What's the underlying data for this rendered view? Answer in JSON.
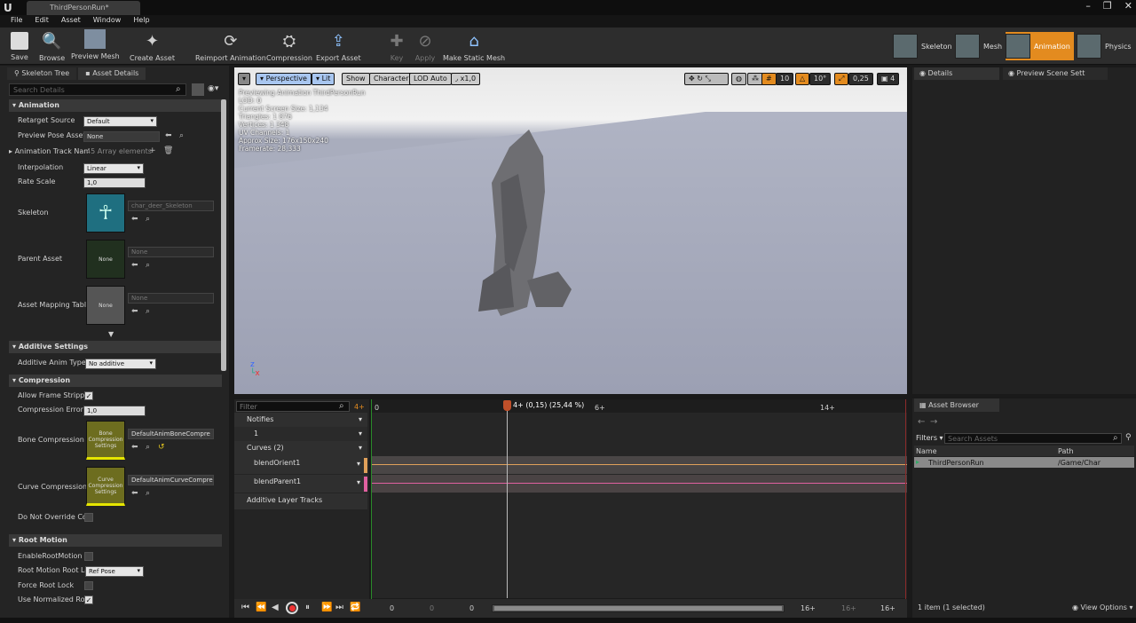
{
  "window": {
    "logo": "U",
    "tab_title": "ThirdPersonRun*"
  },
  "menu": [
    "File",
    "Edit",
    "Asset",
    "Window",
    "Help"
  ],
  "toolbar": {
    "save": "Save",
    "browse": "Browse",
    "preview_mesh": "Preview Mesh",
    "create_asset": "Create Asset",
    "reimport": "Reimport Animation",
    "compression": "Compression",
    "export_asset": "Export Asset",
    "key": "Key",
    "apply": "Apply",
    "make_static_mesh": "Make Static Mesh"
  },
  "modes": {
    "skeleton": "Skeleton",
    "mesh": "Mesh",
    "animation": "Animation",
    "physics": "Physics"
  },
  "left_tabs": {
    "skeleton_tree": "Skeleton Tree",
    "asset_details": "Asset Details"
  },
  "search": {
    "placeholder": "Search Details"
  },
  "animation_section": {
    "title": "Animation",
    "retarget_source_label": "Retarget Source",
    "retarget_source_value": "Default",
    "preview_pose_label": "Preview Pose Asset",
    "preview_pose_value": "None",
    "track_names_label": "Animation Track Nam",
    "track_names_value": "45 Array elements",
    "interpolation_label": "Interpolation",
    "interpolation_value": "Linear",
    "rate_scale_label": "Rate Scale",
    "rate_scale_value": "1,0",
    "skeleton_label": "Skeleton",
    "skeleton_value": "char_deer_Skeleton",
    "parent_asset_label": "Parent Asset",
    "parent_asset_value": "None",
    "parent_thumb": "None",
    "mapping_label": "Asset Mapping Table",
    "mapping_value": "None",
    "mapping_thumb": "None"
  },
  "additive_section": {
    "title": "Additive Settings",
    "type_label": "Additive Anim Type",
    "type_value": "No additive"
  },
  "compression_section": {
    "title": "Compression",
    "allow_stripping_label": "Allow Frame Stripping",
    "error_label": "Compression Error Th",
    "error_value": "1,0",
    "bone_label": "Bone Compression Se",
    "bone_thumb": "Bone Compression Settings",
    "bone_value": "DefaultAnimBoneCompre",
    "curve_label": "Curve Compression S",
    "curve_thumb": "Curve Compression Settings",
    "curve_value": "DefaultAnimCurveCompre",
    "no_override_label": "Do Not Override Comp"
  },
  "root_motion_section": {
    "title": "Root Motion",
    "enable_label": "EnableRootMotion",
    "lock_label": "Root Motion Root Loc",
    "lock_value": "Ref Pose",
    "force_label": "Force Root Lock",
    "normalized_label": "Use Normalized Root"
  },
  "viewport": {
    "perspective": "Perspective",
    "lit": "Lit",
    "show": "Show",
    "character": "Character",
    "lod": "LOD Auto",
    "speed": "x1,0",
    "grid": "10",
    "angle": "10°",
    "scale": "0,25",
    "cam_speed": "4",
    "info": [
      "Previewing Animation ThirdPersonRun",
      "LOD: 0",
      "Current Screen Size: 1,134",
      "Triangles: 1 876",
      "Vertices: 1 348",
      "UV Channels: 1",
      "Approx Size: 176x150x240",
      "Framerate: 28,333"
    ]
  },
  "timeline": {
    "filter": "Filter",
    "frame_badge": "4+",
    "playhead": "4+ (0,15) (25,44 %)",
    "ruler": [
      "0",
      "6+",
      "14+"
    ],
    "notifies": "Notifies",
    "notify_track": "1",
    "curves": "Curves",
    "curves_count": "(2)",
    "curve1": "blendOrient1",
    "curve2": "blendParent1",
    "additive": "Additive Layer Tracks",
    "transport_left": [
      "0",
      "0",
      "0"
    ],
    "transport_right": [
      "16+",
      "16+",
      "16+"
    ]
  },
  "right_tabs": {
    "details": "Details",
    "preview_scene": "Preview Scene Sett"
  },
  "asset_browser": {
    "title": "Asset Browser",
    "filters": "Filters",
    "search_placeholder": "Search Assets",
    "col_name": "Name",
    "col_path": "Path",
    "row_name": "ThirdPersonRun",
    "row_path": "/Game/Char",
    "status": "1 item (1 selected)",
    "view_options": "View Options"
  },
  "colors": {
    "accent": "#e38b1f",
    "curve1": "#e0a05a",
    "curve2": "#e060a0",
    "playhead": "#c0502a"
  }
}
